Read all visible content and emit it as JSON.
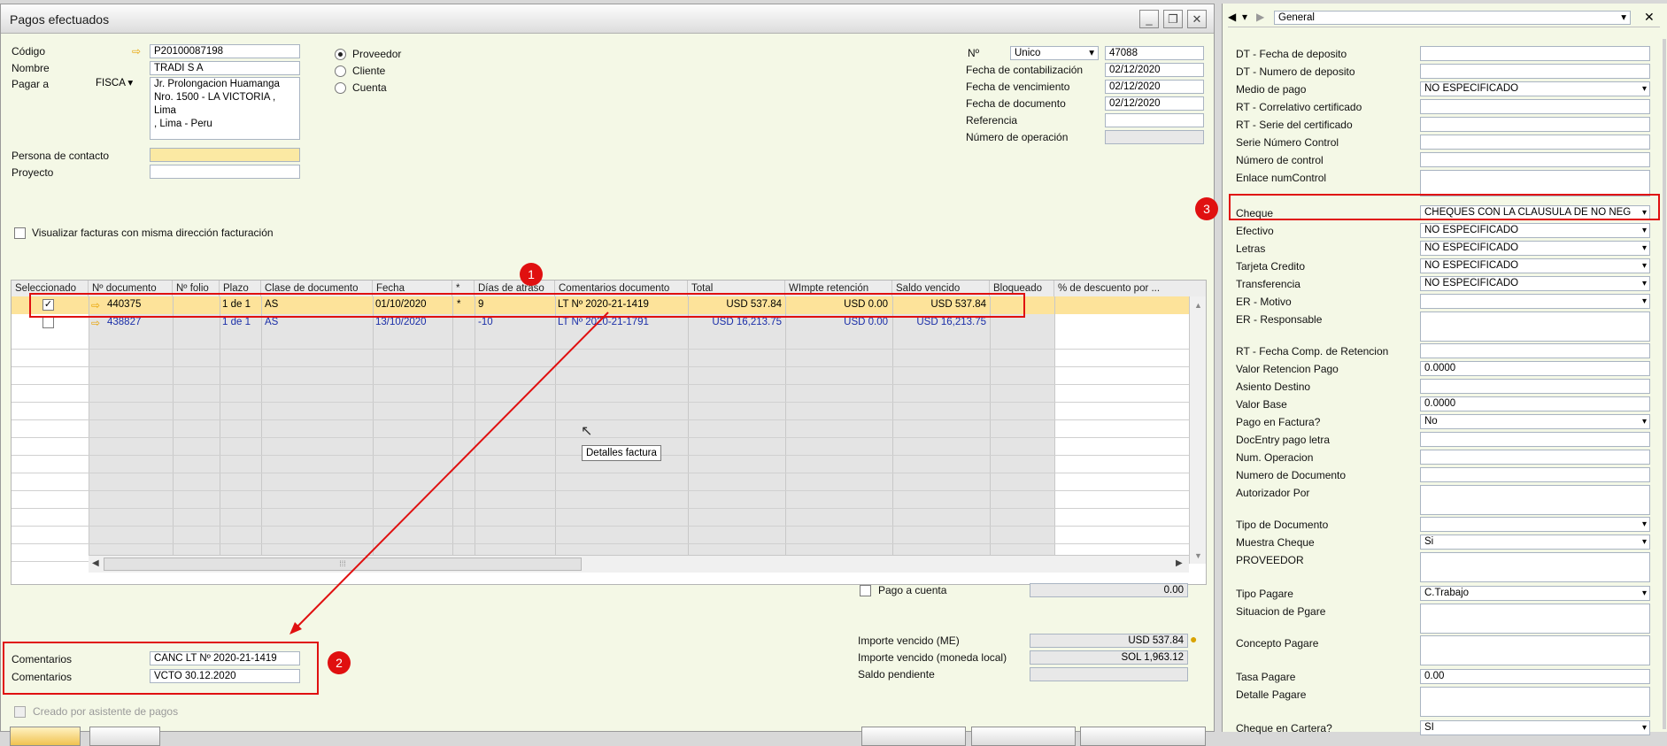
{
  "window": {
    "title": "Pagos efectuados"
  },
  "header": {
    "codigo_label": "Código",
    "codigo_value": "P20100087198",
    "nombre_label": "Nombre",
    "nombre_value": "TRADI S A",
    "pagar_a_label": "Pagar a",
    "pagar_a_select": "FISCA",
    "address_lines": [
      "Jr. Prolongacion Huamanga",
      "Nro. 1500 - LA VICTORIA ,",
      "Lima",
      ", Lima - Peru"
    ],
    "persona_label": "Persona de contacto",
    "proyecto_label": "Proyecto",
    "radios": [
      "Proveedor",
      "Cliente",
      "Cuenta"
    ],
    "no_label": "Nº",
    "no_series": "Unico",
    "no_value": "47088",
    "fecha_contab_label": "Fecha de contabilización",
    "fecha_contab": "02/12/2020",
    "fecha_venc_label": "Fecha de vencimiento",
    "fecha_venc": "02/12/2020",
    "fecha_doc_label": "Fecha de documento",
    "fecha_doc": "02/12/2020",
    "referencia_label": "Referencia",
    "num_op_label": "Número de operación",
    "visualizar_label": "Visualizar facturas con misma dirección facturación"
  },
  "grid": {
    "columns": [
      "Seleccionado",
      "Nº documento",
      "Nº folio",
      "Plazo",
      "Clase de documento",
      "Fecha",
      "*",
      "Días de atraso",
      "Comentarios documento",
      "Total",
      "WImpte retención",
      "Saldo vencido",
      "Bloqueado",
      "% de descuento por ..."
    ],
    "rows": [
      {
        "checked": "✓",
        "doc": "440375",
        "folio": "",
        "plazo": "1 de 1",
        "clase": "AS",
        "fecha": "01/10/2020",
        "star": "*",
        "dias": "9",
        "coment": "LT Nº 2020-21-1419",
        "total": "USD 537.84",
        "ret": "USD 0.00",
        "saldo": "USD 537.84"
      },
      {
        "checked": "",
        "doc": "438827",
        "folio": "",
        "plazo": "1 de 1",
        "clase": "AS",
        "fecha": "13/10/2020",
        "star": "",
        "dias": "-10",
        "coment": "LT Nº 2020-21-1791",
        "total": "USD 16,213.75",
        "ret": "USD 0.00",
        "saldo": "USD 16,213.75"
      }
    ],
    "tooltip": "Detalles factura"
  },
  "footer": {
    "pago_cuenta_label": "Pago a cuenta",
    "pago_cuenta_value": "0.00",
    "importe_me_label": "Importe vencido (ME)",
    "importe_me_value": "USD 537.84",
    "importe_ml_label": "Importe vencido (moneda local)",
    "importe_ml_value": "SOL 1,963.12",
    "saldo_label": "Saldo pendiente",
    "comentarios_label": "Comentarios",
    "comentario1": "CANC LT Nº 2020-21-1419",
    "comentarios2_label": "Comentarios",
    "comentario2": "VCTO 30.12.2020",
    "creado_label": "Creado por asistente de pagos"
  },
  "badges": [
    "1",
    "2",
    "3"
  ],
  "panel": {
    "header_select": "General",
    "fields": [
      {
        "label": "DT - Fecha de deposito",
        "value": ""
      },
      {
        "label": "DT - Numero de deposito",
        "value": ""
      },
      {
        "label": "Medio de pago",
        "value": "NO ESPECIFICADO"
      },
      {
        "label": "RT - Correlativo certificado",
        "value": ""
      },
      {
        "label": "RT - Serie del certificado",
        "value": ""
      },
      {
        "label": "Serie Número Control",
        "value": ""
      },
      {
        "label": "Número de control",
        "value": ""
      },
      {
        "label": "Enlace numControl",
        "value": ""
      },
      {
        "label": "Cheque",
        "value": "CHEQUES CON LA CLAUSULA DE NO NEG"
      },
      {
        "label": "Efectivo",
        "value": "NO ESPECIFICADO"
      },
      {
        "label": "Letras",
        "value": "NO ESPECIFICADO"
      },
      {
        "label": "Tarjeta Credito",
        "value": "NO ESPECIFICADO"
      },
      {
        "label": "Transferencia",
        "value": "NO ESPECIFICADO"
      },
      {
        "label": "ER - Motivo",
        "value": ""
      },
      {
        "label": "ER - Responsable",
        "value": ""
      },
      {
        "label": "RT - Fecha Comp. de Retencion",
        "value": ""
      },
      {
        "label": "Valor Retencion Pago",
        "value": "0.0000"
      },
      {
        "label": "Asiento Destino",
        "value": ""
      },
      {
        "label": "Valor Base",
        "value": "0.0000"
      },
      {
        "label": "Pago en Factura?",
        "value": "No"
      },
      {
        "label": "DocEntry pago letra",
        "value": ""
      },
      {
        "label": "Num. Operacion",
        "value": ""
      },
      {
        "label": "Numero de Documento",
        "value": ""
      },
      {
        "label": "Autorizador Por",
        "value": ""
      },
      {
        "label": "Tipo de Documento",
        "value": ""
      },
      {
        "label": "Muestra Cheque",
        "value": "Si"
      },
      {
        "label": "PROVEEDOR",
        "value": ""
      },
      {
        "label": "Tipo Pagare",
        "value": "C.Trabajo"
      },
      {
        "label": "Situacion de Pgare",
        "value": ""
      },
      {
        "label": "Concepto Pagare",
        "value": ""
      },
      {
        "label": "Tasa Pagare",
        "value": "0.00"
      },
      {
        "label": "Detalle Pagare",
        "value": ""
      },
      {
        "label": "Cheque en Cartera?",
        "value": "SI"
      }
    ]
  },
  "colors": {
    "highlight": "#fde39a",
    "red": "#e01010",
    "link": "#1b2fa8"
  }
}
